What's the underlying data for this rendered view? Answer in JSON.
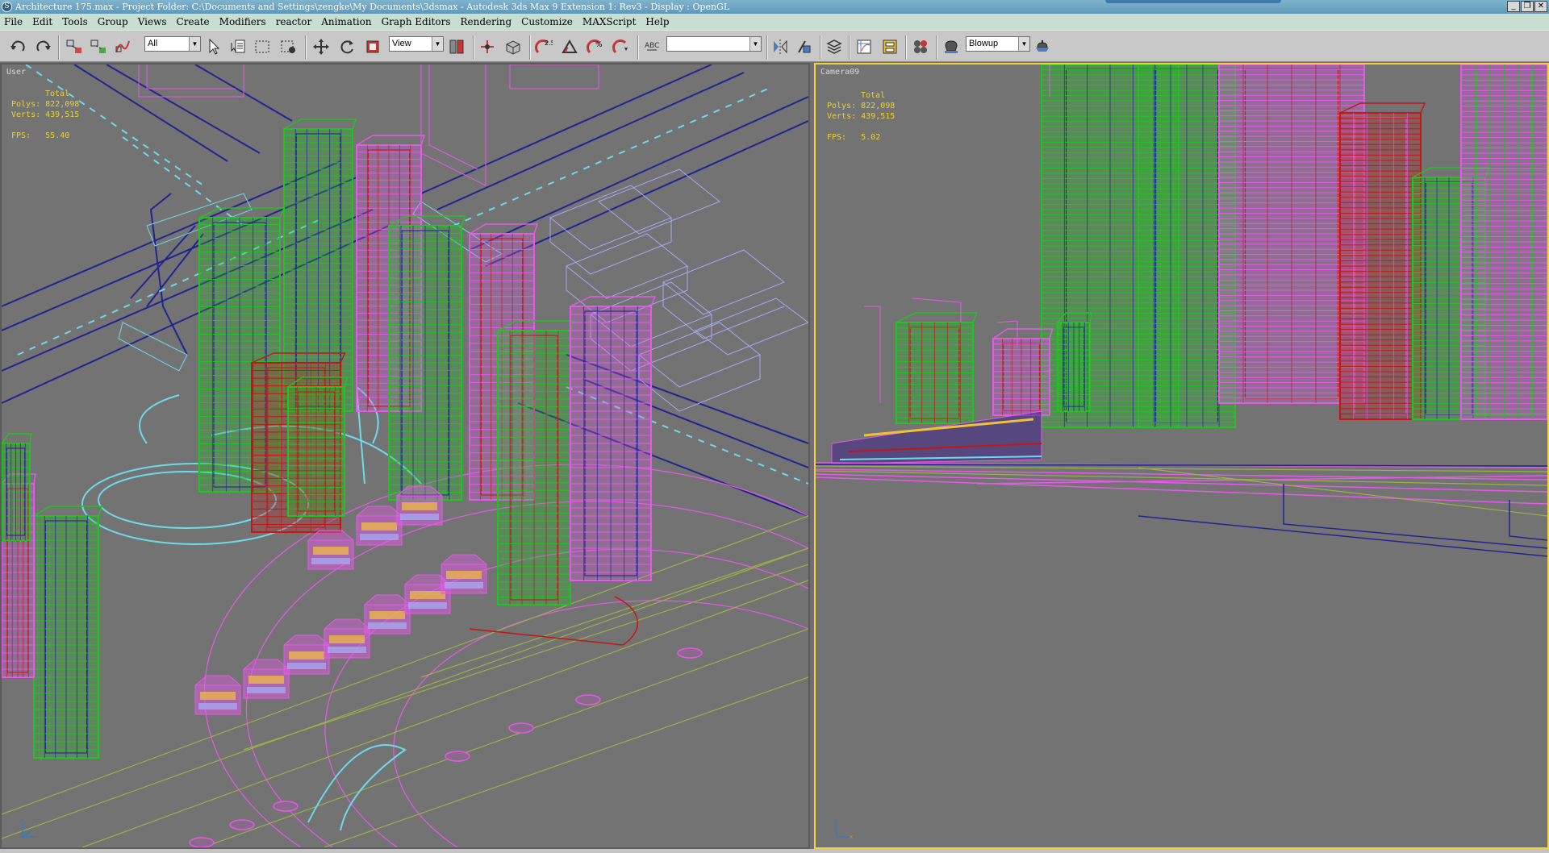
{
  "window": {
    "title": "Architecture 175.max      - Project Folder: C:\\Documents and Settings\\zengke\\My Documents\\3dsmax      - Autodesk 3ds Max 9 Extension 1: Rev3      - Display : OpenGL",
    "controls": [
      "_",
      "❐",
      "✕"
    ]
  },
  "menu": [
    "File",
    "Edit",
    "Tools",
    "Group",
    "Views",
    "Create",
    "Modifiers",
    "reactor",
    "Animation",
    "Graph Editors",
    "Rendering",
    "Customize",
    "MAXScript",
    "Help"
  ],
  "toolbar": {
    "selection_filter": "All",
    "reference_coord": "View",
    "named_selection": "",
    "render_preset": "Blowup"
  },
  "viewports": {
    "left": {
      "label": "User",
      "stats_title": "Total",
      "polys": "Polys: 822,098",
      "verts": "Verts: 439,515",
      "fps": "FPS:   55.40"
    },
    "right": {
      "label": "Camera09",
      "stats_title": "Total",
      "polys": "Polys: 822,098",
      "verts": "Verts: 439,515",
      "fps": "FPS:   5.02"
    }
  },
  "colors": {
    "viewport_bg": "#737373",
    "active_border": "#f2d03e",
    "stats_text": "#e7d23a",
    "green": "#22c322",
    "magenta": "#e45ae8",
    "red": "#c01818",
    "blue": "#1e1e9c",
    "cyan": "#6fd9e9",
    "lavender": "#a8a6f0"
  }
}
